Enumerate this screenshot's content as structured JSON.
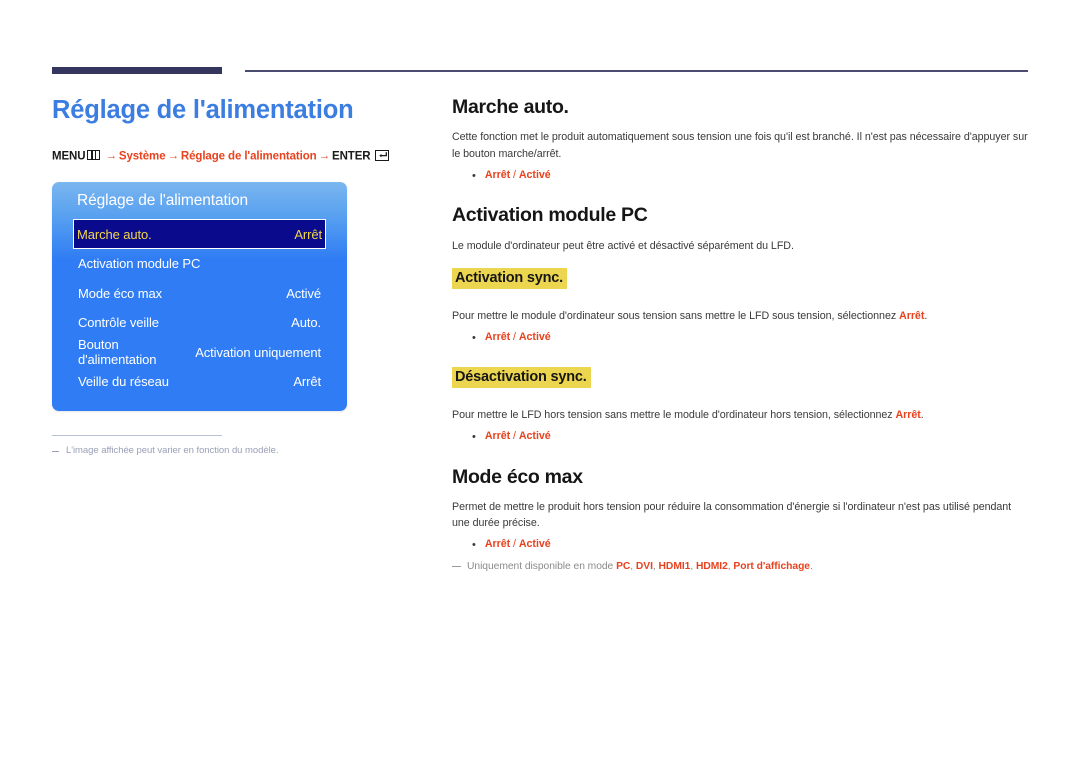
{
  "document": {
    "page_title": "Réglage de l'alimentation",
    "breadcrumb": {
      "menu_label": "MENU",
      "menu_icon": "menu-grid-icon",
      "arrow": "→",
      "step1": "Système",
      "step2": "Réglage de l'alimentation",
      "enter_label": "ENTER",
      "enter_icon": "enter-key-icon"
    },
    "left_footnote": "L'image affichée peut varier en fonction du modèle."
  },
  "osd": {
    "title": "Réglage de l'alimentation",
    "rows": [
      {
        "label": "Marche auto.",
        "value": "Arrêt",
        "selected": true
      },
      {
        "label": "Activation module PC",
        "value": "",
        "selected": false
      },
      {
        "label": "Mode éco max",
        "value": "Activé",
        "selected": false
      },
      {
        "label": "Contrôle veille",
        "value": "Auto.",
        "selected": false
      },
      {
        "label": "Bouton d'alimentation",
        "value": "Activation uniquement",
        "selected": false
      },
      {
        "label": "Veille du réseau",
        "value": "Arrêt",
        "selected": false
      }
    ]
  },
  "sections": {
    "marche_auto": {
      "heading": "Marche auto.",
      "body": "Cette fonction met le produit automatiquement sous tension une fois qu'il est branché. Il n'est pas nécessaire d'appuyer sur le bouton marche/arrêt.",
      "options": {
        "first": "Arrêt",
        "sep": " / ",
        "second": "Activé"
      }
    },
    "activation_module_pc": {
      "heading": "Activation module PC",
      "body": "Le module d'ordinateur peut être activé et désactivé séparément du LFD.",
      "activation_sync": {
        "subheading": "Activation sync.",
        "body_before": "Pour mettre le module d'ordinateur sous tension sans mettre le LFD sous tension, sélectionnez ",
        "body_hot": "Arrêt",
        "body_after": ".",
        "options": {
          "first": "Arrêt",
          "sep": " / ",
          "second": "Activé"
        }
      },
      "desactivation_sync": {
        "subheading": "Désactivation sync.",
        "body_before": "Pour mettre le LFD hors tension sans mettre le module d'ordinateur hors tension, sélectionnez ",
        "body_hot": "Arrêt",
        "body_after": ".",
        "options": {
          "first": "Arrêt",
          "sep": " / ",
          "second": "Activé"
        }
      }
    },
    "mode_eco_max": {
      "heading": "Mode éco max",
      "body": "Permet de mettre le produit hors tension pour réduire la consommation d'énergie si l'ordinateur n'est pas utilisé pendant une durée précise.",
      "options": {
        "first": "Arrêt",
        "sep": " / ",
        "second": "Activé"
      },
      "footnote": {
        "before": "Uniquement disponible en mode ",
        "mode1": "PC",
        "c1": ", ",
        "mode2": "DVI",
        "c2": ", ",
        "mode3": "HDMI1",
        "c3": ", ",
        "mode4": "HDMI2",
        "c4": ", ",
        "mode5": "Port d'affichage",
        "after": "."
      }
    }
  },
  "colors": {
    "title_blue": "#3b7de0",
    "accent_red": "#e8421e",
    "highlight_yellow": "#edd64f",
    "osd_blue": "#2f7cf4",
    "osd_selected_bg": "#0a0a8c",
    "osd_selected_text": "#f3d747",
    "rule_navy": "#34365e"
  }
}
